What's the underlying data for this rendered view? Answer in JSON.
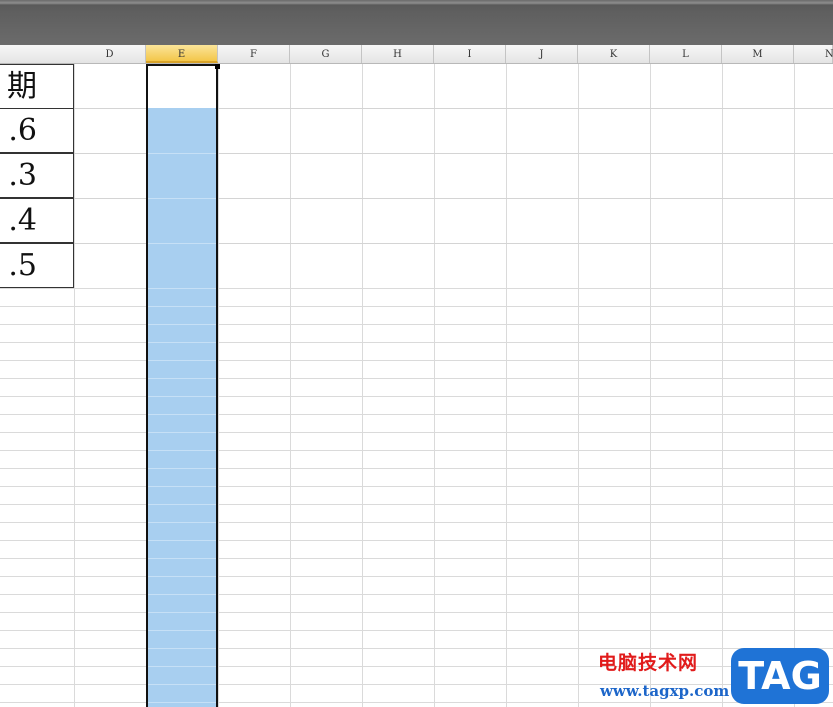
{
  "columns": [
    {
      "label": "D"
    },
    {
      "label": "E"
    },
    {
      "label": "F"
    },
    {
      "label": "G"
    },
    {
      "label": "H"
    },
    {
      "label": "I"
    },
    {
      "label": "J"
    },
    {
      "label": "K"
    },
    {
      "label": "L"
    },
    {
      "label": "M"
    },
    {
      "label": "N"
    }
  ],
  "active_column": "E",
  "cells": [
    "期",
    ".6",
    ".3",
    ".4",
    ".5"
  ],
  "selection_color": "#a8cff0",
  "watermark": {
    "title": "电脑技术网",
    "url": "www.tagxp.com",
    "badge": "TAG",
    "badge_color": "#1f73d6"
  }
}
